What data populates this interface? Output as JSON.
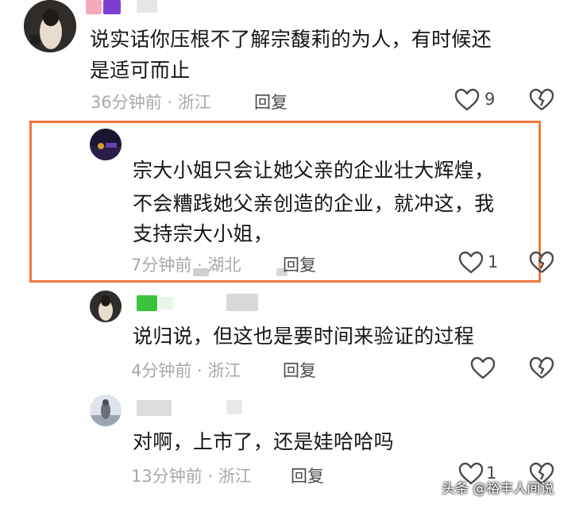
{
  "comments": [
    {
      "text_lines": [
        "说实话你压根不了解宗馥莉的为人，有时候还",
        "是适可而止"
      ],
      "time_location": "36分钟前 · 浙江",
      "reply_label": "回复",
      "like_count": "9"
    },
    {
      "text_lines": [
        "宗大小姐只会让她父亲的企业壮大辉煌，",
        "不会糟践她父亲创造的企业，就冲这，我",
        "支持宗大小姐，"
      ],
      "time_location": "7分钟前 · 湖北",
      "reply_label": "回复",
      "like_count": "1"
    },
    {
      "text_lines": [
        "说归说，但这也是要时间来验证的过程"
      ],
      "time_location": "4分钟前 · 浙江",
      "reply_label": "回复",
      "like_count": ""
    },
    {
      "text_lines": [
        "对啊，上市了，还是娃哈哈吗"
      ],
      "time_location": "13分钟前 · 浙江",
      "reply_label": "回复",
      "like_count": "1"
    }
  ],
  "watermark": "头条 @裕丰人间说",
  "colors": {
    "highlight_border": "#f2773b",
    "meta_text": "#a9a9a9",
    "body_text": "#161616"
  },
  "icons": [
    "heart-outline-icon",
    "broken-heart-icon"
  ]
}
